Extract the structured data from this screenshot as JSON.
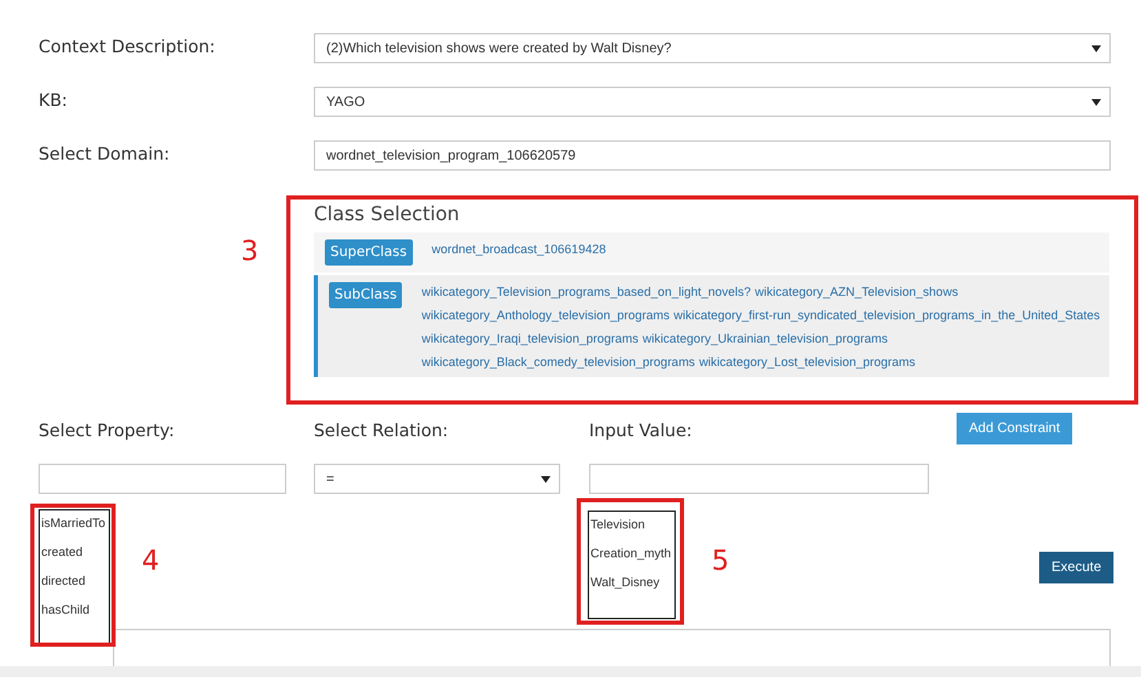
{
  "form": [
    {
      "label": "Context Description:",
      "kind": "select",
      "value": "(2)Which television shows were created by Walt Disney?"
    },
    {
      "label": "KB:",
      "kind": "select",
      "value": "YAGO"
    },
    {
      "label": "Select Domain:",
      "kind": "input",
      "value": "wordnet_television_program_106620579"
    }
  ],
  "class_selection": {
    "title": "Class Selection",
    "annotation": "3",
    "superclass": {
      "badge": "SuperClass",
      "links": [
        "wordnet_broadcast_106619428"
      ]
    },
    "subclass": {
      "badge": "SubClass",
      "lines": [
        [
          "wikicategory_Television_programs_based_on_light_novels?",
          "wikicategory_AZN_Television_shows"
        ],
        [
          "wikicategory_Anthology_television_programs",
          "wikicategory_first-run_syndicated_television_programs_in_the_United_States"
        ],
        [
          "wikicategory_Iraqi_television_programs",
          "wikicategory_Ukrainian_television_programs"
        ],
        [
          "wikicategory_Black_comedy_television_programs",
          "wikicategory_Lost_television_programs"
        ]
      ]
    }
  },
  "constraint": {
    "property_label": "Select Property:",
    "relation_label": "Select Relation:",
    "value_label": "Input Value:",
    "add_button": "Add Constraint",
    "relation": "=",
    "property_suggestions": {
      "annotation": "4",
      "items": [
        "isMarriedTo",
        "created",
        "directed",
        "hasChild"
      ]
    },
    "value_suggestions": {
      "annotation": "5",
      "items": [
        "Television",
        "Creation_myth",
        "Walt_Disney"
      ]
    },
    "execute_button": "Execute"
  }
}
